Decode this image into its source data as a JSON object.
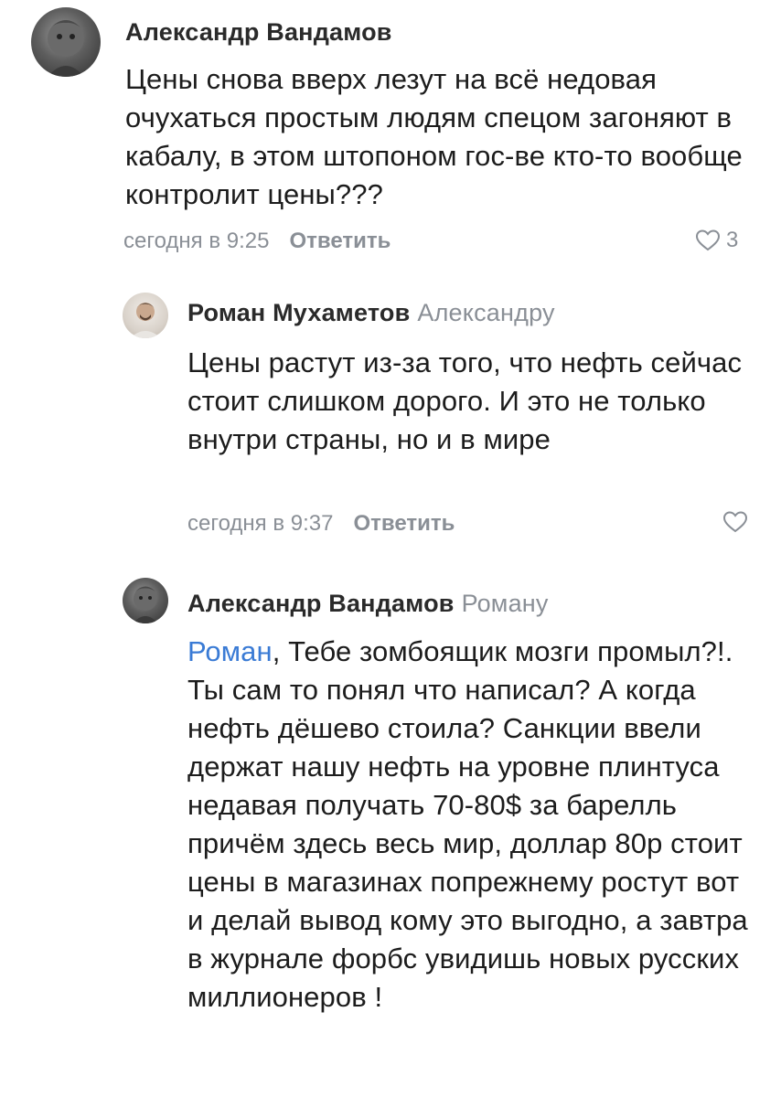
{
  "comments": [
    {
      "author": "Александр Вандамов",
      "reply_to": "",
      "avatar_icon": "avatar-child-photo",
      "text": "Цены снова вверх лезут на всё недовая очухаться простым людям спецом загоняют в кабалу, в этом штопоном гос-ве кто-то вообще контролит цены???",
      "time": "сегодня в 9:25",
      "reply_label": "Ответить",
      "likes": "3"
    },
    {
      "author": "Роман Мухаметов",
      "reply_to": "Александру",
      "avatar_icon": "avatar-man-photo",
      "text": "Цены растут из-за того, что нефть сейчас стоит слишком дорого. И это не только внутри страны, но и в мире",
      "time": "сегодня в 9:37",
      "reply_label": "Ответить",
      "likes": ""
    },
    {
      "author": "Александр Вандамов",
      "reply_to": "Роману",
      "avatar_icon": "avatar-child-photo",
      "mention": "Роман",
      "text": ", Тебе зомбоящик мозги промыл?!. Ты сам то понял что написал? А когда нефть дёшево стоила? Санкции ввели держат нашу нефть на уровне плинтуса недавая получать 70-80$ за барелль причём здесь весь мир,  доллар 80р стоит  цены в магазинах попрежнему ростут вот и делай вывод кому это выгодно, а завтра в журнале форбс увидишь новых русских миллионеров !"
    }
  ],
  "colors": {
    "mention": "#3a7bd5",
    "meta": "#8a8f96",
    "text": "#1c1c1c"
  }
}
